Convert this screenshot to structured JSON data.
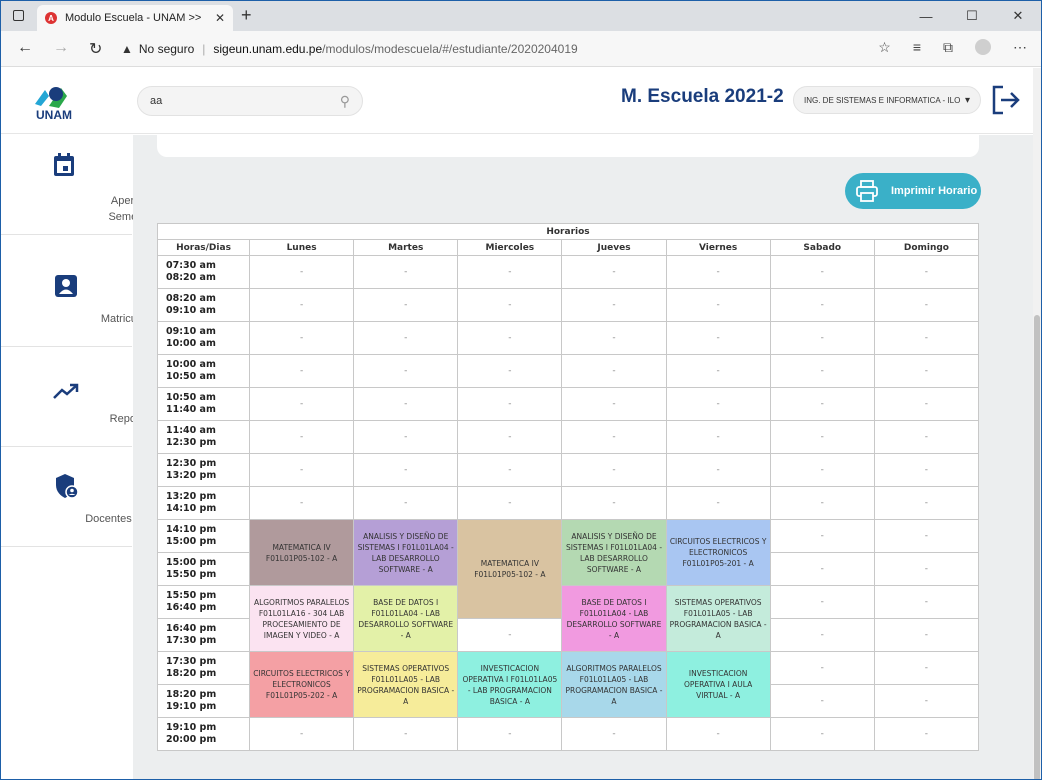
{
  "browser": {
    "tab_title": "Modulo Escuela - UNAM >>",
    "security_label": "No seguro",
    "url_host": "sigeun.unam.edu.pe",
    "url_path": "/modulos/modescuela/#/estudiante/2020204019"
  },
  "header": {
    "logo_text": "UNAM",
    "search_value": "aa",
    "title": "M. Escuela 2021-2",
    "school_select": "ING. DE SISTEMAS E INFORMATICA - ILO"
  },
  "sidebar": {
    "items": [
      {
        "label1": "Apertura",
        "label2": "Semestre"
      },
      {
        "label1": "Matriculados",
        "label2": ""
      },
      {
        "label1": "Reportes",
        "label2": ""
      },
      {
        "label1": "Docentes R.R.H.H.",
        "label2": ""
      }
    ]
  },
  "print_button": "Imprimir Horario",
  "schedule": {
    "caption": "Horarios",
    "headers": [
      "Horas/Dias",
      "Lunes",
      "Martes",
      "Miercoles",
      "Jueves",
      "Viernes",
      "Sabado",
      "Domingo"
    ],
    "empty": "-",
    "hours": [
      [
        "07:30 am",
        "08:20 am"
      ],
      [
        "08:20 am",
        "09:10 am"
      ],
      [
        "09:10 am",
        "10:00 am"
      ],
      [
        "10:00 am",
        "10:50 am"
      ],
      [
        "10:50 am",
        "11:40 am"
      ],
      [
        "11:40 am",
        "12:30 pm"
      ],
      [
        "12:30 pm",
        "13:20 pm"
      ],
      [
        "13:20 pm",
        "14:10 pm"
      ],
      [
        "14:10 pm",
        "15:00 pm"
      ],
      [
        "15:00 pm",
        "15:50 pm"
      ],
      [
        "15:50 pm",
        "16:40 pm"
      ],
      [
        "16:40 pm",
        "17:30 pm"
      ],
      [
        "17:30 pm",
        "18:20 pm"
      ],
      [
        "18:20 pm",
        "19:10 pm"
      ],
      [
        "19:10 pm",
        "20:00 pm"
      ]
    ],
    "courses": {
      "lun_1": {
        "text": "MATEMATICA IV F01L01P05-102 - A",
        "color": "#b09a9c"
      },
      "mar_1": {
        "text": "ANALISIS Y DISEÑO DE SISTEMAS I F01L01LA04 - LAB DESARROLLO SOFTWARE - A",
        "color": "#b59fd6"
      },
      "mie_1": {
        "text": "MATEMATICA IV F01L01P05-102 - A",
        "color": "#d9c3a1"
      },
      "jue_1": {
        "text": "ANALISIS Y DISEÑO DE SISTEMAS I F01L01LA04 - LAB DESARROLLO SOFTWARE - A",
        "color": "#b4d9b2"
      },
      "vie_1": {
        "text": "CIRCUITOS ELECTRICOS Y ELECTRONICOS F01L01P05-201 - A",
        "color": "#a9c6f2"
      },
      "lun_2": {
        "text": "ALGORITMOS PARALELOS F01L01LA16 - 304 LAB PROCESAMIENTO DE IMAGEN Y VIDEO - A",
        "color": "#fbe3f1"
      },
      "mar_2": {
        "text": "BASE DE DATOS I F01L01LA04 - LAB DESARROLLO SOFTWARE - A",
        "color": "#e3f1a8"
      },
      "jue_2": {
        "text": "BASE DE DATOS I F01L01LA04 - LAB DESARROLLO SOFTWARE - A",
        "color": "#f19ae0"
      },
      "vie_2": {
        "text": "SISTEMAS OPERATIVOS F01L01LA05 - LAB PROGRAMACION BASICA - A",
        "color": "#c4ebdb"
      },
      "lun_3": {
        "text": "CIRCUITOS ELECTRICOS Y ELECTRONICOS F01L01P05-202 - A",
        "color": "#f4a0a4"
      },
      "mar_3": {
        "text": "SISTEMAS OPERATIVOS F01L01LA05 - LAB PROGRAMACION BASICA - A",
        "color": "#f6ec9a"
      },
      "mie_3": {
        "text": "INVESTICACION OPERATIVA I F01L01LA05 - LAB PROGRAMACION BASICA - A",
        "color": "#8ef0e0"
      },
      "jue_3": {
        "text": "ALGORITMOS PARALELOS F01L01LA05 - LAB PROGRAMACION BASICA - A",
        "color": "#a8d8ea"
      },
      "vie_3": {
        "text": "INVESTICACION OPERATIVA I AULA VIRTUAL - A",
        "color": "#8ef0e0"
      }
    }
  }
}
